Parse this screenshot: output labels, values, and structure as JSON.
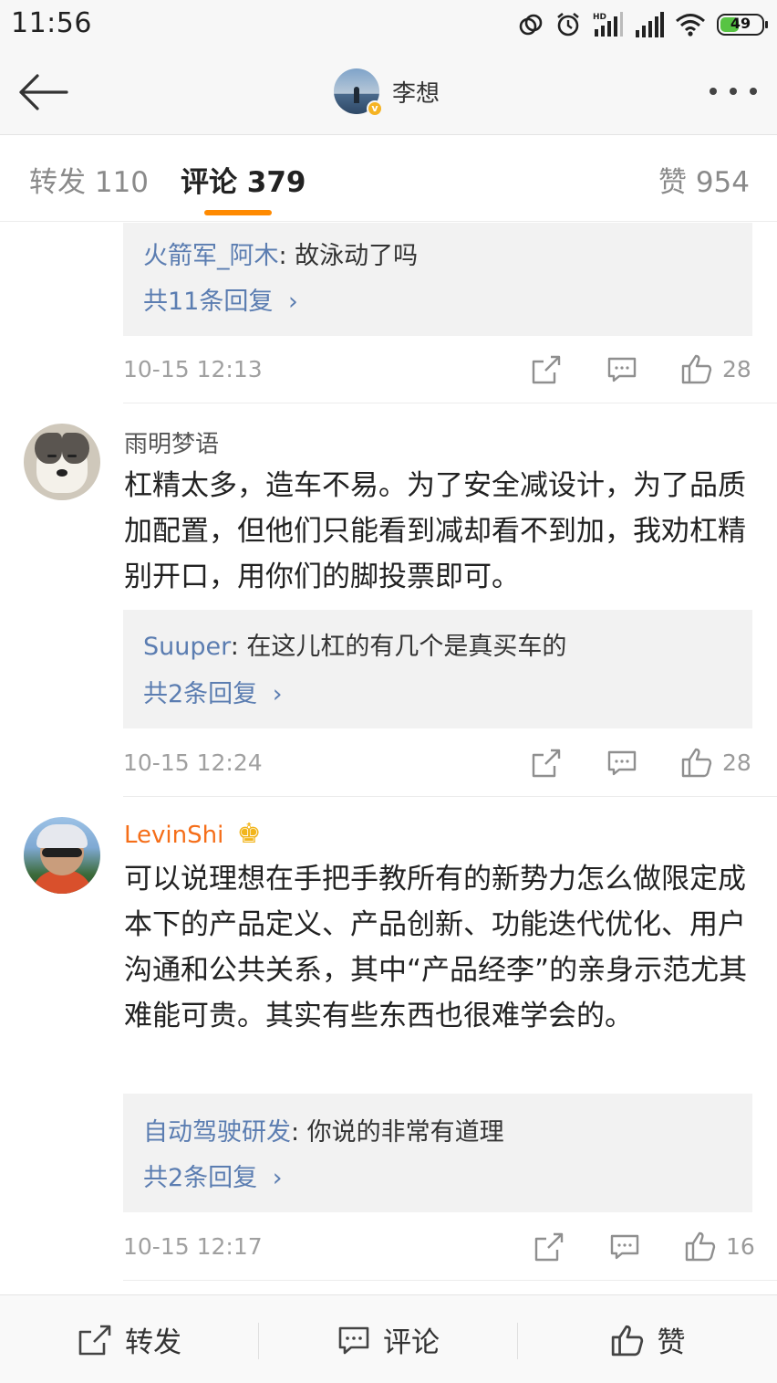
{
  "status_bar": {
    "time": "11:56",
    "battery": "49",
    "battery_level": 0.49,
    "icons": [
      "link-icon",
      "alarm-icon",
      "hd-signal-icon",
      "signal-icon",
      "wifi-icon",
      "battery-icon"
    ]
  },
  "nav": {
    "title": "李想",
    "verified_badge": "v"
  },
  "tabs": {
    "repost": "转发 110",
    "comments": "评论 379",
    "likes": "赞 954"
  },
  "comments": [
    {
      "reply": {
        "user": "火箭军_阿木",
        "text": ": 故泳动了吗",
        "count": "共11条回复"
      },
      "time": "10-15 12:13",
      "likes": "28"
    },
    {
      "user": "雨明梦语",
      "text": "杠精太多，造车不易。为了安全减设计，为了品质加配置，但他们只能看到减却看不到加，我劝杠精别开口，用你们的脚投票即可。",
      "reply": {
        "user": "Suuper",
        "text": ": 在这儿杠的有几个是真买车的",
        "count": "共2条回复"
      },
      "time": "10-15 12:24",
      "likes": "28"
    },
    {
      "user": "LevinShi",
      "crown": "♚",
      "text": "可以说理想在手把手教所有的新势力怎么做限定成本下的产品定义、产品创新、功能迭代优化、用户沟通和公共关系，其中“产品经李”的亲身示范尤其难能可贵。其实有些东西也很难学会的。",
      "reply": {
        "user": "自动驾驶研发",
        "text": ": 你说的非常有道理",
        "count": "共2条回复"
      },
      "time": "10-15 12:17",
      "likes": "16"
    }
  ],
  "chevron": "›",
  "bottom_bar": {
    "repost": "转发",
    "comment": "评论",
    "like": "赞"
  }
}
